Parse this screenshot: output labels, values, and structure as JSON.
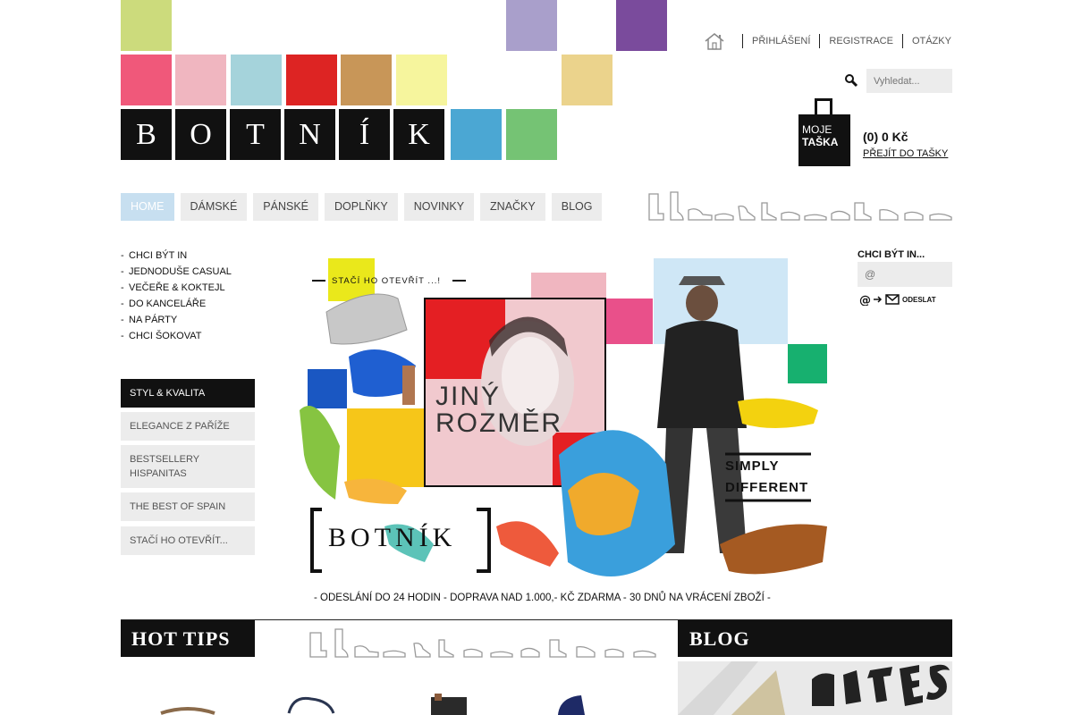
{
  "brand": {
    "letters": [
      "B",
      "O",
      "T",
      "N",
      "Í",
      "K"
    ]
  },
  "colors": {
    "tiles": [
      "#ccdb7c",
      "#a99fcb",
      "#7a4b9c",
      "#f0587a",
      "#f0b6c0",
      "#a5d3db",
      "#dd2423",
      "#c89658",
      "#f6f59d",
      "#ebd38c",
      "#4ba7d3",
      "#75c374"
    ],
    "nav_active": "#c7dff0",
    "nav_bg": "#ececec"
  },
  "top_links": {
    "home_icon": "home-icon",
    "login": "Přihlášení",
    "register": "Registrace",
    "faq": "Otázky"
  },
  "search": {
    "placeholder": "Vyhledat...",
    "icon": "search-icon"
  },
  "cart": {
    "bag_line1": "MOJE",
    "bag_line2": "TAŠKA",
    "total": "(0) 0 Kč",
    "link": "PŘEJÍT DO TAŠKY"
  },
  "nav": {
    "items": [
      {
        "label": "HOME"
      },
      {
        "label": "DÁMSKÉ"
      },
      {
        "label": "PÁNSKÉ"
      },
      {
        "label": "DOPLŇKY"
      },
      {
        "label": "NOVINKY"
      },
      {
        "label": "ZNAČKY"
      },
      {
        "label": "BLOG"
      }
    ]
  },
  "categories": {
    "items": [
      {
        "label": "CHCI BÝT IN"
      },
      {
        "label": "JEDNODUŠE CASUAL"
      },
      {
        "label": "VEČEŘE & KOKTEJL"
      },
      {
        "label": "DO KANCELÁŘE"
      },
      {
        "label": "NA PÁRTY"
      },
      {
        "label": "CHCI ŠOKOVAT"
      }
    ]
  },
  "side_boxes": {
    "items": [
      {
        "label": "STYL & KVALITA"
      },
      {
        "label": "ELEGANCE Z PAŘÍŽE"
      },
      {
        "label": "BESTSELLERY HISPANITAS"
      },
      {
        "label": "THE BEST OF SPAIN"
      },
      {
        "label": "STAČÍ HO OTEVŘÍT..."
      }
    ]
  },
  "hero": {
    "tagline_top": "STAČÍ HO OTEVŘÍT ...!",
    "jiny_line1": "JINÝ",
    "jiny_line2": "ROZMĚR",
    "simply_line1": "SIMPLY",
    "simply_line2": "DIFFERENT",
    "brand": "BOTNÍK",
    "footer": "- ODESLÁNÍ DO 24 HODIN - DOPRAVA NAD 1.000,- KČ ZDARMA - 30 DNŮ NA VRÁCENÍ ZBOŽÍ -"
  },
  "newsletter": {
    "title": "CHCI BÝT IN...",
    "placeholder": "@",
    "send_label": "ODESLAT"
  },
  "sections": {
    "hot_tips": "HOT TIPS",
    "blog": "BLOG"
  }
}
